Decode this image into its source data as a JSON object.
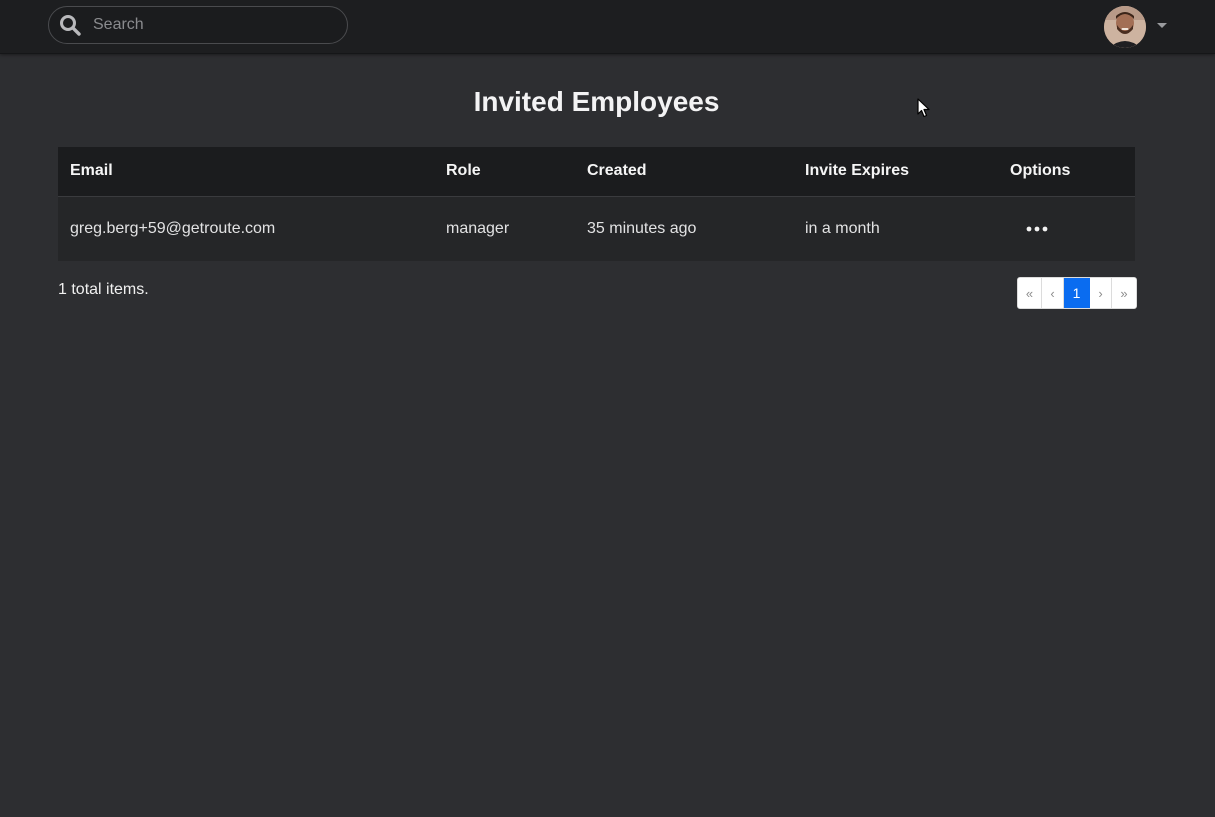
{
  "header": {
    "search": {
      "placeholder": "Search",
      "value": ""
    },
    "avatar_icon": "user-avatar",
    "menu_caret_icon": "caret-down-icon"
  },
  "page": {
    "title": "Invited Employees"
  },
  "table": {
    "columns": [
      "Email",
      "Role",
      "Created",
      "Invite Expires",
      "Options"
    ],
    "rows": [
      {
        "email": "greg.berg+59@getroute.com",
        "role": "manager",
        "created": "35 minutes ago",
        "expires": "in a month",
        "options_icon": "more-horizontal-icon"
      }
    ]
  },
  "footer": {
    "total_text": "1 total items.",
    "pagination": {
      "first": "«",
      "prev": "‹",
      "current": "1",
      "next": "›",
      "last": "»"
    }
  },
  "colors": {
    "background": "#2d2e31",
    "topbar": "#1d1e20",
    "table_header": "#1b1c1e",
    "table_row": "#252628",
    "accent": "#0a6cf0"
  }
}
